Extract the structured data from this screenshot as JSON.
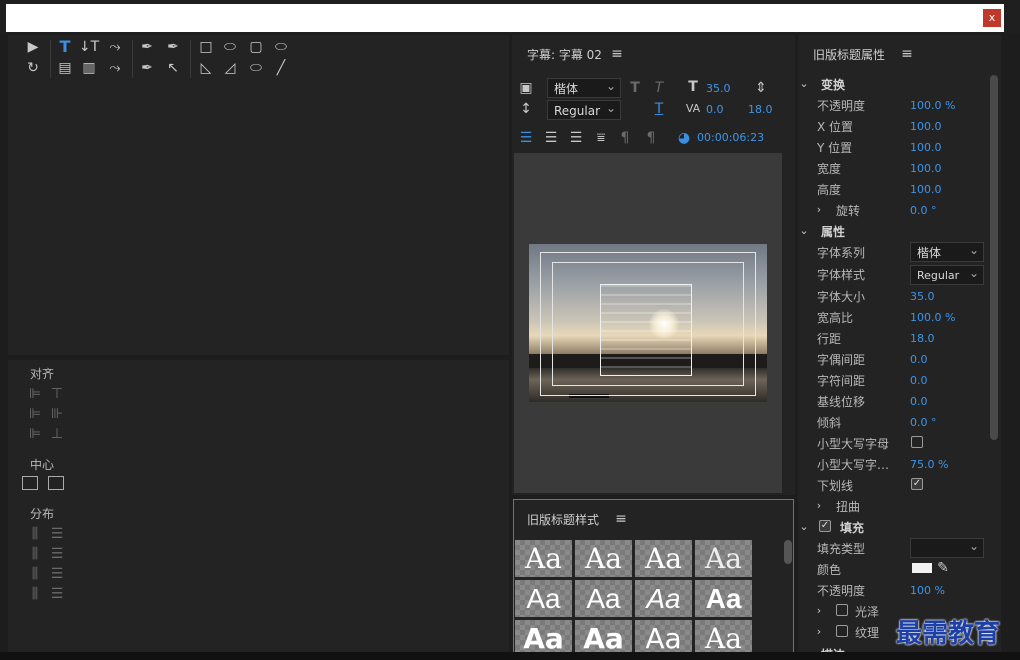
{
  "window": {
    "close_label": "x"
  },
  "tools": {
    "row1": [
      "▶",
      "T",
      "↓T",
      "⤳",
      "✒",
      "✒",
      "□",
      "⬭",
      "▢",
      "⬭"
    ],
    "row2": [
      "↻",
      "▤",
      "▥",
      "⤳",
      "✒",
      "↖",
      "◺",
      "◿",
      "⬭",
      "╱"
    ]
  },
  "align_panel": {
    "align_title": "对齐",
    "center_title": "中心",
    "distribute_title": "分布"
  },
  "subtitle_panel": {
    "title": "字幕: 字幕 02",
    "font_family": "楷体",
    "font_style": "Regular",
    "font_size": "35.0",
    "tracking": "0.0",
    "leading": "18.0",
    "timecode": "00:00:06:23"
  },
  "styles_panel": {
    "title": "旧版标题样式",
    "swatches": [
      "Aa",
      "Aa",
      "Aa",
      "Aa",
      "Aa",
      "Aa",
      "Aa",
      "Aa",
      "Aa",
      "Aa",
      "Aa",
      "Aa"
    ]
  },
  "props_panel": {
    "title": "旧版标题属性",
    "transform": {
      "section": "变换",
      "opacity_label": "不透明度",
      "opacity": "100.0 %",
      "x_label": "X 位置",
      "x": "100.0",
      "y_label": "Y 位置",
      "y": "100.0",
      "width_label": "宽度",
      "width": "100.0",
      "height_label": "高度",
      "height": "100.0",
      "rotation_label": "旋转",
      "rotation": "0.0 °"
    },
    "properties": {
      "section": "属性",
      "family_label": "字体系列",
      "family": "楷体",
      "style_label": "字体样式",
      "style": "Regular",
      "size_label": "字体大小",
      "size": "35.0",
      "aspect_label": "宽高比",
      "aspect": "100.0 %",
      "leading_label": "行距",
      "leading": "18.0",
      "kerning_label": "字偶间距",
      "kerning": "0.0",
      "tracking_label": "字符间距",
      "tracking": "0.0",
      "baseline_label": "基线位移",
      "baseline": "0.0",
      "slant_label": "倾斜",
      "slant": "0.0 °",
      "smallcaps_label": "小型大写字母",
      "smallcaps_size_label": "小型大写字…",
      "smallcaps_size": "75.0 %",
      "underline_label": "下划线",
      "distort_label": "扭曲"
    },
    "fill": {
      "section": "填充",
      "type_label": "填充类型",
      "color_label": "颜色",
      "opacity_label": "不透明度",
      "opacity": "100 %",
      "sheen_label": "光泽",
      "texture_label": "纹理"
    },
    "stroke_section": "描边"
  },
  "watermark": {
    "text": "最需教育"
  },
  "colors": {
    "accent": "#3d95e8",
    "panel": "#232323",
    "bg": "#1d1d1d"
  }
}
